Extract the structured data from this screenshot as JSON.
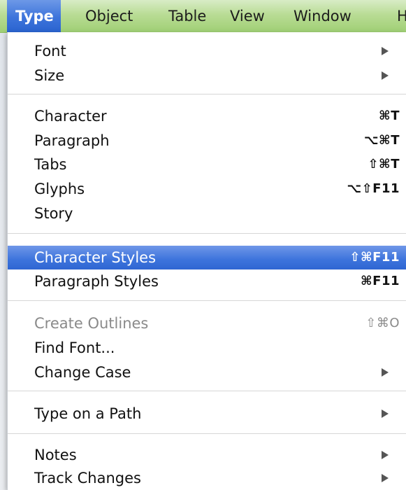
{
  "menubar": {
    "items": [
      {
        "label": "Type",
        "active": true
      },
      {
        "label": "Object"
      },
      {
        "label": "Table"
      },
      {
        "label": "View"
      },
      {
        "label": "Window"
      },
      {
        "label": "H"
      }
    ]
  },
  "menu": {
    "items": [
      {
        "label": "Font",
        "submenu": true
      },
      {
        "label": "Size",
        "submenu": true
      },
      {
        "label": "Character",
        "shortcut": "⌘T"
      },
      {
        "label": "Paragraph",
        "shortcut": "⌥⌘T"
      },
      {
        "label": "Tabs",
        "shortcut": "⇧⌘T"
      },
      {
        "label": "Glyphs",
        "shortcut": "⌥⇧F11"
      },
      {
        "label": "Story"
      },
      {
        "label": "Character Styles",
        "shortcut": "⇧⌘F11",
        "selected": true
      },
      {
        "label": "Paragraph Styles",
        "shortcut": "⌘F11"
      },
      {
        "label": "Create Outlines",
        "shortcut": "⇧⌘O",
        "disabled": true
      },
      {
        "label": "Find Font..."
      },
      {
        "label": "Change Case",
        "submenu": true
      },
      {
        "label": "Type on a Path",
        "submenu": true
      },
      {
        "label": "Notes",
        "submenu": true
      },
      {
        "label": "Track Changes",
        "submenu": true
      }
    ]
  },
  "colors": {
    "menubar_green": "#b9dc95",
    "selection_blue": "#3c73dc"
  }
}
